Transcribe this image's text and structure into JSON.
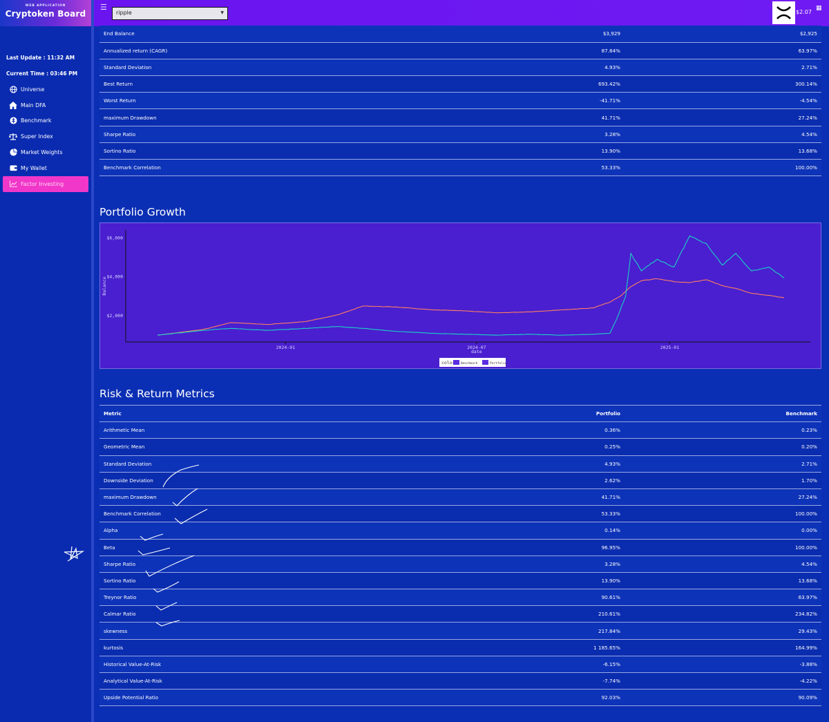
{
  "sidebar": {
    "brand_sub": "WEB APPLICATION",
    "brand_title": "Cryptoken Board",
    "last_update": "Last Update : 11:32 AM",
    "current_time": "Current Time : 03:46 PM",
    "items": [
      {
        "label": "Universe",
        "icon": "globe-icon"
      },
      {
        "label": "Main DFA",
        "icon": "home-icon"
      },
      {
        "label": "Benchmark",
        "icon": "benchmark-icon"
      },
      {
        "label": "Super Index",
        "icon": "scale-icon"
      },
      {
        "label": "Market Weights",
        "icon": "pie-chart-icon"
      },
      {
        "label": "My Wallet",
        "icon": "wallet-icon"
      },
      {
        "label": "Factor Investing",
        "icon": "line-chart-icon"
      }
    ],
    "active_index": 6,
    "active_color": "#f037c9"
  },
  "header": {
    "selected_coin": "ripple",
    "coin_logo": "xrp-logo-icon",
    "price": "$2.07"
  },
  "summary_table": {
    "rows": [
      [
        "End Balance",
        "$3,929",
        "$2,925"
      ],
      [
        "Annualized return (CAGR)",
        "87.84%",
        "63.97%"
      ],
      [
        "Standard Deviation",
        "4.93%",
        "2.71%"
      ],
      [
        "Best Return",
        "693.42%",
        "300.14%"
      ],
      [
        "Worst Return",
        "-41.71%",
        "-4.54%"
      ],
      [
        "maximum Drawdown",
        "41.71%",
        "27.24%"
      ],
      [
        "Sharpe Ratio",
        "3.28%",
        "4.54%"
      ],
      [
        "Sortino Ratio",
        "13.90%",
        "13.68%"
      ],
      [
        "Benchmark Correlation",
        "53.33%",
        "100.00%"
      ]
    ]
  },
  "growth": {
    "title": "Portfolio Growth"
  },
  "chart_data": {
    "type": "line",
    "title": "",
    "xlabel": "date",
    "ylabel": "Balance",
    "x_ticks": [
      "2024-01",
      "2024-07",
      "2025-01"
    ],
    "y_ticks": [
      "$2,000",
      "$4,000",
      "$6,000"
    ],
    "ylim": [
      900,
      6400
    ],
    "x_range": [
      "2023-09-01",
      "2025-04-20"
    ],
    "legend_title": "color",
    "legend_position": "bottom-center",
    "grid": false,
    "series": [
      {
        "name": "Benchmark",
        "color": "#ff7f5f",
        "x": [
          "2023-09-01",
          "2023-10-15",
          "2023-11-10",
          "2023-12-15",
          "2024-01-20",
          "2024-02-20",
          "2024-03-15",
          "2024-04-15",
          "2024-05-20",
          "2024-06-20",
          "2024-07-20",
          "2024-08-20",
          "2024-09-20",
          "2024-10-20",
          "2024-11-05",
          "2024-11-15",
          "2024-11-25",
          "2024-12-05",
          "2024-12-20",
          "2025-01-05",
          "2025-01-20",
          "2025-02-05",
          "2025-02-20",
          "2025-03-05",
          "2025-03-20",
          "2025-04-05",
          "2025-04-20"
        ],
        "y": [
          1000,
          1300,
          1650,
          1550,
          1700,
          2050,
          2500,
          2450,
          2300,
          2250,
          2150,
          2200,
          2300,
          2400,
          2700,
          3000,
          3500,
          3800,
          3900,
          3750,
          3700,
          3850,
          3550,
          3400,
          3150,
          3050,
          2925
        ]
      },
      {
        "name": "Portfolio",
        "color": "#19d3c5",
        "x": [
          "2023-09-01",
          "2023-10-15",
          "2023-11-10",
          "2023-12-15",
          "2024-01-20",
          "2024-02-20",
          "2024-03-15",
          "2024-04-15",
          "2024-05-20",
          "2024-06-20",
          "2024-07-20",
          "2024-08-20",
          "2024-09-20",
          "2024-10-20",
          "2024-11-05",
          "2024-11-12",
          "2024-11-20",
          "2024-11-25",
          "2024-12-05",
          "2024-12-20",
          "2025-01-05",
          "2025-01-20",
          "2025-02-05",
          "2025-02-20",
          "2025-03-05",
          "2025-03-20",
          "2025-04-05",
          "2025-04-20"
        ],
        "y": [
          1000,
          1250,
          1350,
          1250,
          1350,
          1450,
          1350,
          1200,
          1100,
          1050,
          1000,
          1050,
          1000,
          1050,
          1100,
          1900,
          3000,
          5200,
          4300,
          4900,
          4500,
          6100,
          5700,
          4600,
          5200,
          4300,
          4500,
          3929
        ]
      }
    ]
  },
  "risk": {
    "title": "Risk & Return Metrics",
    "headers": [
      "Metric",
      "Portfolio",
      "Benchmark"
    ],
    "rows": [
      [
        "Arithmetic Mean",
        "0.36%",
        "0.23%"
      ],
      [
        "Geometric Mean",
        "0.25%",
        "0.20%"
      ],
      [
        "Standard Deviation",
        "4.93%",
        "2.71%"
      ],
      [
        "Downside Deviation",
        "2.62%",
        "1.70%"
      ],
      [
        "maximum Drawdown",
        "41.71%",
        "27.24%"
      ],
      [
        "Benchmark Correlation",
        "53.33%",
        "100.00%"
      ],
      [
        "Alpha",
        "0.14%",
        "0.00%"
      ],
      [
        "Beta",
        "96.95%",
        "100.00%"
      ],
      [
        "Sharpe Ratio",
        "3.28%",
        "4.54%"
      ],
      [
        "Sortino Ratio",
        "13.90%",
        "13.68%"
      ],
      [
        "Treynor Ratio",
        "90.61%",
        "63.97%"
      ],
      [
        "Calmar Ratio",
        "210.61%",
        "234.82%"
      ],
      [
        "skewness",
        "217.84%",
        "29.43%"
      ],
      [
        "kurtosis",
        "1 185.65%",
        "164.99%"
      ],
      [
        "Historical Value-At-Risk",
        "-6.15%",
        "-3.88%"
      ],
      [
        "Analytical Value-At-Risk",
        "-7.74%",
        "-4.22%"
      ],
      [
        "Upside Potential Ratio",
        "92.03%",
        "90.09%"
      ]
    ]
  }
}
